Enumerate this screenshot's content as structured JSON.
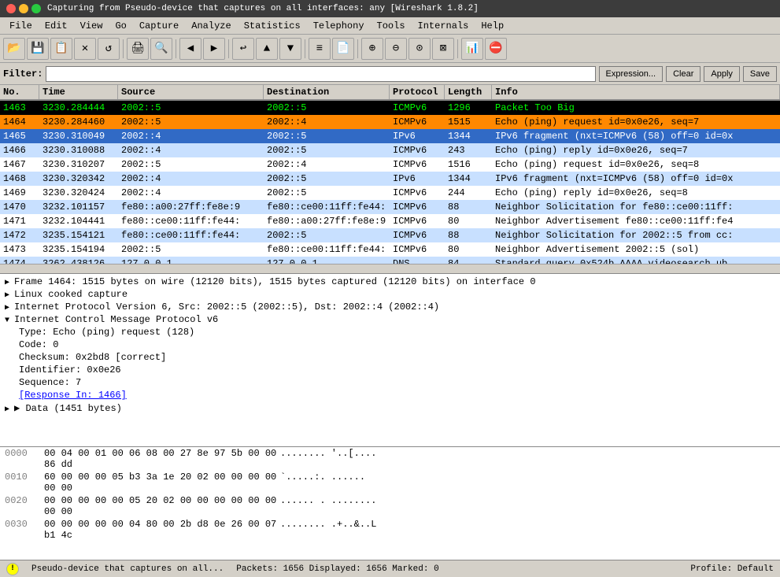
{
  "titleBar": {
    "text": "Capturing from Pseudo-device that captures on all interfaces: any   [Wireshark 1.8.2]",
    "closeBtn": "×",
    "minBtn": "−",
    "maxBtn": "□"
  },
  "menu": {
    "items": [
      "File",
      "Edit",
      "View",
      "Go",
      "Capture",
      "Analyze",
      "Statistics",
      "Telephony",
      "Tools",
      "Internals",
      "Help"
    ]
  },
  "toolbar": {
    "buttons": [
      "📂",
      "💾",
      "📋",
      "✖",
      "🔄",
      "🖨️",
      "🔍",
      "◀",
      "▶",
      "↩",
      "⬆",
      "⬇",
      "☰",
      "📄",
      "⊕",
      "⊖",
      "⊠",
      "⊙",
      "📈",
      "🗑️",
      "?"
    ]
  },
  "filter": {
    "label": "Filter:",
    "placeholder": "",
    "expressionBtn": "Expression...",
    "clearBtn": "Clear",
    "applyBtn": "Apply",
    "saveBtn": "Save"
  },
  "packetList": {
    "headers": [
      "No.",
      "Time",
      "Source",
      "Destination",
      "Protocol",
      "Length",
      "Info"
    ],
    "rows": [
      {
        "no": "1463",
        "time": "3230.284444",
        "src": "2002::5",
        "dst": "2002::5",
        "proto": "ICMPv6",
        "len": "1296",
        "info": "Packet Too Big",
        "style": "row-black"
      },
      {
        "no": "1464",
        "time": "3230.284460",
        "src": "2002::5",
        "dst": "2002::4",
        "proto": "ICMPv6",
        "len": "1515",
        "info": "Echo (ping) request id=0x0e26, seq=7",
        "style": "row-orange"
      },
      {
        "no": "1465",
        "time": "3230.310049",
        "src": "2002::4",
        "dst": "2002::5",
        "proto": "IPv6",
        "len": "1344",
        "info": "IPv6 fragment (nxt=ICMPv6 (58) off=0 id=0x",
        "style": "row-selected"
      },
      {
        "no": "1466",
        "time": "3230.310088",
        "src": "2002::4",
        "dst": "2002::5",
        "proto": "ICMPv6",
        "len": "243",
        "info": "Echo (ping) reply id=0x0e26, seq=7",
        "style": "row-light-blue"
      },
      {
        "no": "1467",
        "time": "3230.310207",
        "src": "2002::5",
        "dst": "2002::4",
        "proto": "ICMPv6",
        "len": "1516",
        "info": "Echo (ping) request id=0x0e26, seq=8",
        "style": "row-white"
      },
      {
        "no": "1468",
        "time": "3230.320342",
        "src": "2002::4",
        "dst": "2002::5",
        "proto": "IPv6",
        "len": "1344",
        "info": "IPv6 fragment (nxt=ICMPv6 (58) off=0 id=0x",
        "style": "row-light-blue"
      },
      {
        "no": "1469",
        "time": "3230.320424",
        "src": "2002::4",
        "dst": "2002::5",
        "proto": "ICMPv6",
        "len": "244",
        "info": "Echo (ping) reply id=0x0e26, seq=8",
        "style": "row-white"
      },
      {
        "no": "1470",
        "time": "3232.101157",
        "src": "fe80::a00:27ff:fe8e:9",
        "dst": "fe80::ce00:11ff:fe44:",
        "proto": "ICMPv6",
        "len": "88",
        "info": "Neighbor Solicitation for fe80::ce00:11ff:",
        "style": "row-light-blue"
      },
      {
        "no": "1471",
        "time": "3232.104441",
        "src": "fe80::ce00:11ff:fe44:",
        "dst": "fe80::a00:27ff:fe8e:9",
        "proto": "ICMPv6",
        "len": "80",
        "info": "Neighbor Advertisement fe80::ce00:11ff:fe4",
        "style": "row-white"
      },
      {
        "no": "1472",
        "time": "3235.154121",
        "src": "fe80::ce00:11ff:fe44:",
        "dst": "2002::5",
        "proto": "ICMPv6",
        "len": "88",
        "info": "Neighbor Solicitation for 2002::5 from cc:",
        "style": "row-light-blue"
      },
      {
        "no": "1473",
        "time": "3235.154194",
        "src": "2002::5",
        "dst": "fe80::ce00:11ff:fe44:",
        "proto": "ICMPv6",
        "len": "80",
        "info": "Neighbor Advertisement 2002::5 (sol)",
        "style": "row-white"
      },
      {
        "no": "1474",
        "time": "3262.438126",
        "src": "127.0.0.1",
        "dst": "127.0.0.1",
        "proto": "DNS",
        "len": "84",
        "info": "Standard query 0x524b  AAAA videosearch.ub",
        "style": "row-light-blue"
      }
    ]
  },
  "detailPane": {
    "lines": [
      {
        "text": "Frame 1464: 1515 bytes on wire (12120 bits), 1515 bytes captured (12120 bits) on interface 0",
        "type": "expandable",
        "indent": 0
      },
      {
        "text": "Linux cooked capture",
        "type": "expandable",
        "indent": 0
      },
      {
        "text": "Internet Protocol Version 6, Src: 2002::5 (2002::5), Dst: 2002::4 (2002::4)",
        "type": "expandable",
        "indent": 0
      },
      {
        "text": "Internet Control Message Protocol v6",
        "type": "expanded",
        "indent": 0
      },
      {
        "text": "Type: Echo (ping) request (128)",
        "type": "normal",
        "indent": 1
      },
      {
        "text": "Code: 0",
        "type": "normal",
        "indent": 1
      },
      {
        "text": "Checksum: 0x2bd8 [correct]",
        "type": "normal",
        "indent": 1
      },
      {
        "text": "Identifier: 0x0e26",
        "type": "normal",
        "indent": 1
      },
      {
        "text": "Sequence: 7",
        "type": "normal",
        "indent": 1
      },
      {
        "text": "[Response In: 1466]",
        "type": "link",
        "indent": 1
      },
      {
        "text": "▶ Data (1451 bytes)",
        "type": "expandable-data",
        "indent": 0
      }
    ]
  },
  "hexPane": {
    "rows": [
      {
        "offset": "0000",
        "bytes": "00 04 00 01 00 06 08 00  27 8e 97 5b 00 00 86 dd",
        "ascii": "........  '..[...."
      },
      {
        "offset": "0010",
        "bytes": "60 00 00 00 05 b3 3a 1e  20 02 00 00 00 00 00 00",
        "ascii": "`.....:. ......"
      },
      {
        "offset": "0020",
        "bytes": "00 00 00 00 00 05 20 02  00 00 00 00 00 00 00 00",
        "ascii": "...... . ........"
      },
      {
        "offset": "0030",
        "bytes": "00 00 00 00 00 04 80 00  2b d8 0e 26 00 07 b1 4c",
        "ascii": "........ .+..&..L"
      }
    ]
  },
  "statusBar": {
    "deviceText": "Pseudo-device that captures on all...",
    "packetsText": "Packets: 1656  Displayed: 1656  Marked: 0",
    "profileText": "Profile: Default"
  }
}
